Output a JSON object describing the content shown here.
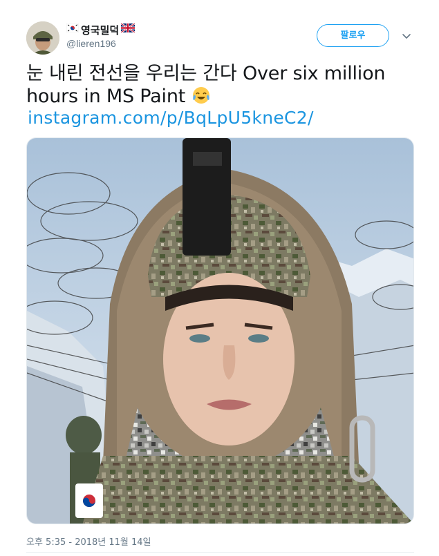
{
  "user": {
    "display_name": "영국밀덕",
    "handle": "@lieren196",
    "flags": [
      "korea-flag-icon",
      "uk-flag-icon"
    ]
  },
  "follow_button": {
    "label": "팔로우"
  },
  "tweet": {
    "text": "눈 내린 전선을 우리는 간다 Over six million hours in MS Paint",
    "emoji": "face-with-tears-of-joy-icon",
    "link": "instagram.com/p/BqLpU5kneC2/"
  },
  "media": {
    "description_icon": "soldier-photo"
  },
  "timestamp": "오후 5:35 - 2018년 11월 14일",
  "colors": {
    "accent": "#1da1f2",
    "link": "#1b95e0",
    "muted": "#657786"
  }
}
